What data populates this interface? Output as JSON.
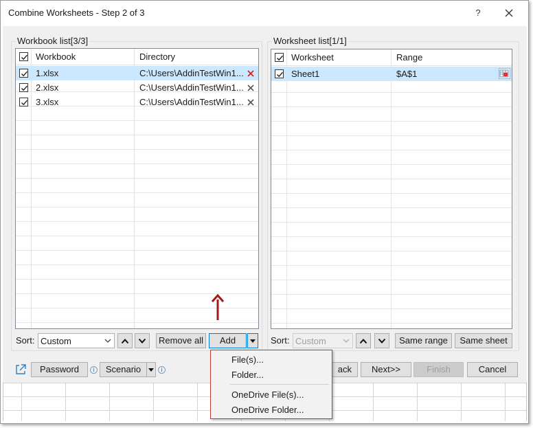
{
  "window": {
    "title": "Combine Worksheets - Step 2 of 3",
    "help_label": "?"
  },
  "workbook_list": {
    "title": "Workbook list[3/3]",
    "headers": {
      "name": "Workbook",
      "directory": "Directory"
    },
    "rows": [
      {
        "name": "1.xlsx",
        "directory": "C:\\Users\\AddinTestWin1...",
        "checked": true,
        "selected": true
      },
      {
        "name": "2.xlsx",
        "directory": "C:\\Users\\AddinTestWin1...",
        "checked": true,
        "selected": false
      },
      {
        "name": "3.xlsx",
        "directory": "C:\\Users\\AddinTestWin1...",
        "checked": true,
        "selected": false
      }
    ],
    "sort_label": "Sort:",
    "sort_value": "Custom",
    "remove_all_label": "Remove all",
    "add_label": "Add"
  },
  "worksheet_list": {
    "title": "Worksheet list[1/1]",
    "headers": {
      "name": "Worksheet",
      "range": "Range"
    },
    "rows": [
      {
        "name": "Sheet1",
        "range": "$A$1",
        "checked": true,
        "selected": true
      }
    ],
    "sort_label": "Sort:",
    "sort_value": "Custom",
    "same_range_label": "Same range",
    "same_sheet_label": "Same sheet"
  },
  "footer": {
    "password_label": "Password",
    "scenario_label": "Scenario",
    "info_glyph": "i",
    "back_label_visible": "ack",
    "next_label": "Next>>",
    "finish_label": "Finish",
    "cancel_label": "Cancel"
  },
  "add_menu": {
    "items": [
      "File(s)...",
      "Folder...",
      "OneDrive File(s)...",
      "OneDrive Folder..."
    ]
  },
  "colors": {
    "selection": "#cce8ff",
    "dialog_bg": "#f0f0f0",
    "accent_border": "#0078d7",
    "annotation_red": "#b22222"
  }
}
